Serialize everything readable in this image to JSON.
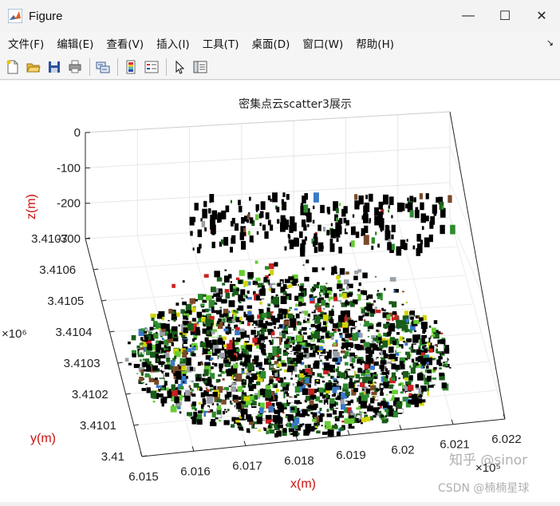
{
  "window": {
    "title": "Figure",
    "controls": [
      "—",
      "☐",
      "✕"
    ]
  },
  "menu": [
    "文件(F)",
    "编辑(E)",
    "查看(V)",
    "插入(I)",
    "工具(T)",
    "桌面(D)",
    "窗口(W)",
    "帮助(H)"
  ],
  "menu_overflow": "↘",
  "toolbar": [
    "new-figure-icon",
    "open-icon",
    "save-icon",
    "print-icon",
    "link-icon",
    "insert-colorbar-icon",
    "insert-legend-icon",
    "pointer-icon",
    "property-inspector-icon"
  ],
  "chart_data": {
    "type": "scatter",
    "subtype": "scatter3",
    "title": "密集点云scatter3展示",
    "xlabel": "x(m)",
    "ylabel": "y(m)",
    "zlabel": "z(m)",
    "x_exponent": "×10⁵",
    "y_exponent": "×10⁶",
    "xticks": [
      "6.015",
      "6.016",
      "6.017",
      "6.018",
      "6.019",
      "6.02",
      "6.021",
      "6.022"
    ],
    "yticks": [
      "3.41",
      "3.4101",
      "3.4102",
      "3.4103",
      "3.4104",
      "3.4105",
      "3.4106",
      "3.4107"
    ],
    "zticks": [
      "0",
      "-100",
      "-200",
      "-300"
    ],
    "xlim": [
      601500,
      602200
    ],
    "ylim": [
      3410000,
      3410700
    ],
    "zlim": [
      -300,
      0
    ],
    "grid": true,
    "label_color": "#cc1111",
    "point_colors": [
      "#000000",
      "#ffffff",
      "#1a5c1a",
      "#2e8b2e",
      "#66cc33",
      "#d4d400",
      "#3a78c8",
      "#cc2020",
      "#7a4a2a",
      "#9aa0a8"
    ]
  },
  "watermark": {
    "line1": "知乎 @sinor",
    "line2": "CSDN @楠楠星球"
  }
}
